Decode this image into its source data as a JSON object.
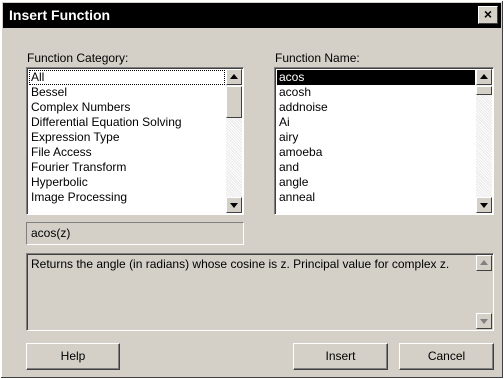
{
  "window": {
    "title": "Insert Function",
    "close_glyph": "×"
  },
  "category": {
    "label": "Function Category:",
    "items": [
      "All",
      "Bessel",
      "Complex Numbers",
      "Differential Equation Solving",
      "Expression Type",
      "File Access",
      "Fourier Transform",
      "Hyperbolic",
      "Image Processing"
    ],
    "selected": "All"
  },
  "function": {
    "label": "Function Name:",
    "items": [
      "acos",
      "acosh",
      "addnoise",
      "Ai",
      "airy",
      "amoeba",
      "and",
      "angle",
      "anneal"
    ],
    "selected": "acos"
  },
  "signature": "acos(z)",
  "description": "Returns the angle (in radians) whose cosine is z. Principal value for complex z.",
  "buttons": {
    "help": "Help",
    "insert": "Insert",
    "cancel": "Cancel"
  },
  "colors": {
    "titlebar": "#000000",
    "face": "#d4d0c8",
    "selection": "#000000"
  }
}
